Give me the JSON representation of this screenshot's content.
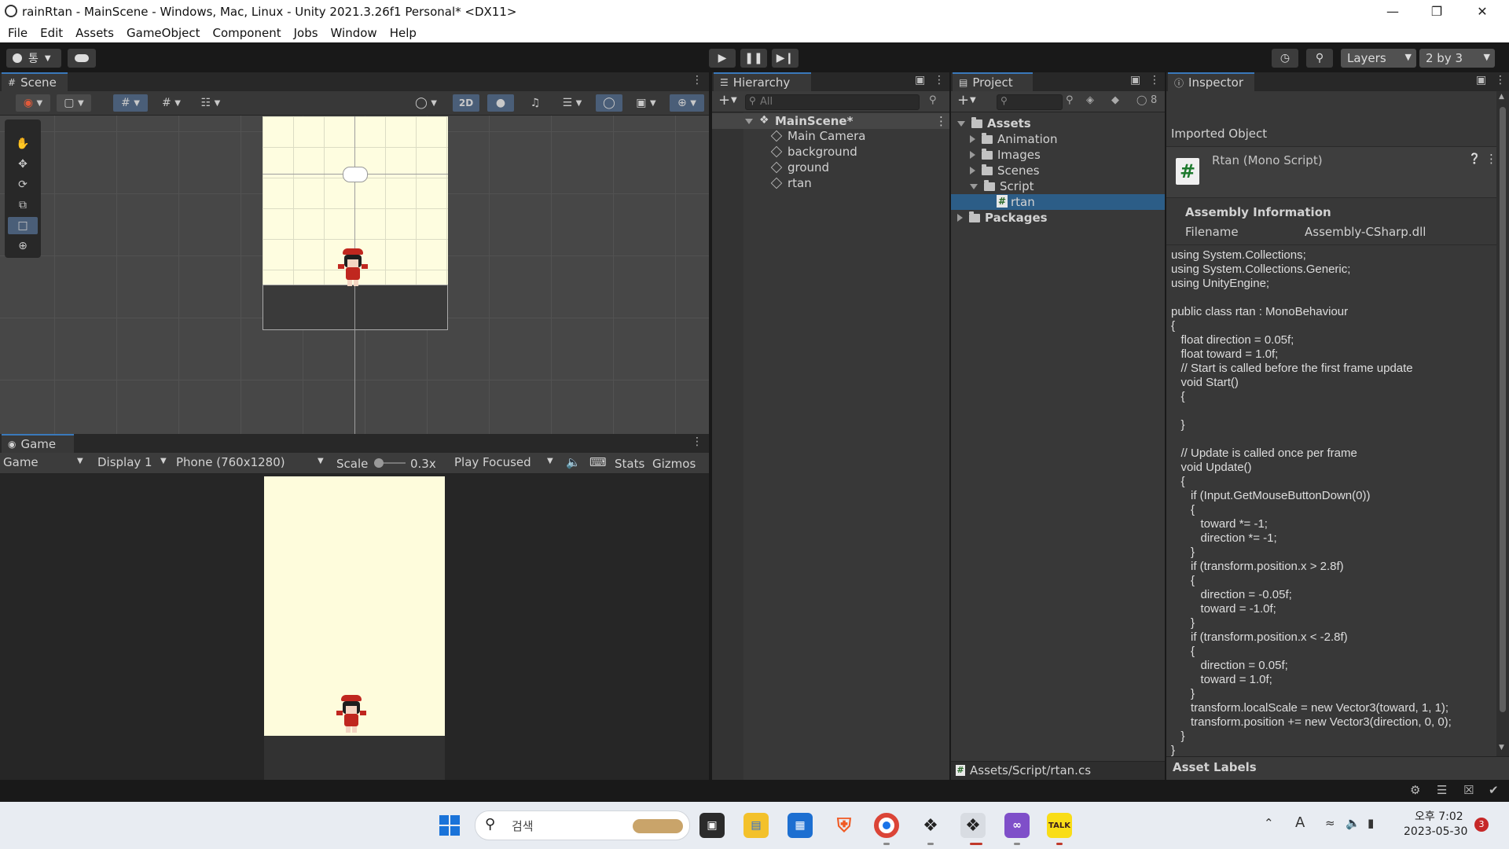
{
  "window": {
    "title": "rainRtan - MainScene - Windows, Mac, Linux - Unity 2021.3.26f1 Personal* <DX11>"
  },
  "menu": [
    "File",
    "Edit",
    "Assets",
    "GameObject",
    "Component",
    "Jobs",
    "Window",
    "Help"
  ],
  "toolbar": {
    "account": "통",
    "layers_label": "Layers",
    "layout_label": "2 by 3"
  },
  "scene": {
    "tab_label": "Scene",
    "mode_2d": "2D"
  },
  "game": {
    "tab_label": "Game",
    "view_dropdown": "Game",
    "display_dropdown": "Display 1",
    "resolution_dropdown": "Phone (760x1280)",
    "scale_label": "Scale",
    "scale_value": "0.3x",
    "play_focused": "Play Focused",
    "stats": "Stats",
    "gizmos": "Gizmos"
  },
  "hierarchy": {
    "tab_label": "Hierarchy",
    "search_placeholder": "All",
    "scene_name": "MainScene*",
    "items": [
      "Main Camera",
      "background",
      "ground",
      "rtan"
    ]
  },
  "project": {
    "tab_label": "Project",
    "hidden_count": "8",
    "root": "Assets",
    "folders": [
      "Animation",
      "Images",
      "Scenes",
      "Script"
    ],
    "selected_file": "rtan",
    "packages": "Packages",
    "footer_path": "Assets/Script/rtan.cs"
  },
  "inspector": {
    "tab_label": "Inspector",
    "imported_object": "Imported Object",
    "object_name": "Rtan (Mono Script)",
    "assembly_header": "Assembly Information",
    "filename_label": "Filename",
    "filename_value": "Assembly-CSharp.dll",
    "code": "using System.Collections;\nusing System.Collections.Generic;\nusing UnityEngine;\n\npublic class rtan : MonoBehaviour\n{\n   float direction = 0.05f;\n   float toward = 1.0f;\n   // Start is called before the first frame update\n   void Start()\n   {\n\n   }\n\n   // Update is called once per frame\n   void Update()\n   {\n      if (Input.GetMouseButtonDown(0))\n      {\n         toward *= -1;\n         direction *= -1;\n      }\n      if (transform.position.x > 2.8f)\n      {\n         direction = -0.05f;\n         toward = -1.0f;\n      }\n      if (transform.position.x < -2.8f)\n      {\n         direction = 0.05f;\n         toward = 1.0f;\n      }\n      transform.localScale = new Vector3(toward, 1, 1);\n      transform.position += new Vector3(direction, 0, 0);\n   }\n}",
    "asset_labels": "Asset Labels"
  },
  "taskbar": {
    "search_text": "검색",
    "time": "오후 7:02",
    "date": "2023-05-30",
    "notification_count": "3",
    "ime": "A"
  }
}
